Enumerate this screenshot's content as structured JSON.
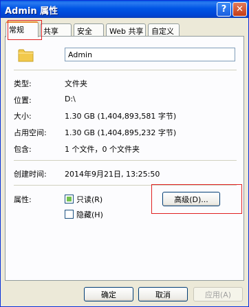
{
  "window": {
    "title": "Admin 属性",
    "help_label": "?",
    "close_label": "✕"
  },
  "tabs": [
    {
      "label": "常规",
      "active": true
    },
    {
      "label": "共享"
    },
    {
      "label": "安全"
    },
    {
      "label": "Web 共享"
    },
    {
      "label": "自定义"
    }
  ],
  "general": {
    "folder_name": "Admin",
    "type_label": "类型:",
    "type_value": "文件夹",
    "location_label": "位置:",
    "location_value": "D:\\",
    "size_label": "大小:",
    "size_value": "1.30 GB (1,404,893,581 字节)",
    "disk_size_label": "占用空间:",
    "disk_size_value": "1.30 GB (1,404,895,232 字节)",
    "contains_label": "包含:",
    "contains_value": "1 个文件，0 个文件夹",
    "created_label": "创建时间:",
    "created_value": "2014年9月21日, 13:25:50",
    "attributes_label": "属性:",
    "readonly_label": "只读(R)",
    "readonly_state": "indeterminate",
    "hidden_label": "隐藏(H)",
    "hidden_state": "unchecked",
    "advanced_label": "高级(D)..."
  },
  "footer": {
    "ok_label": "确定",
    "cancel_label": "取消",
    "apply_label": "应用(A)"
  },
  "icons": {
    "folder": "folder-icon",
    "help": "help-icon",
    "close": "close-icon"
  },
  "colors": {
    "titlebar": "#0055e5",
    "dialog_bg": "#ece9d8",
    "highlight_box": "#e02020",
    "folder": "#f2c94c"
  }
}
